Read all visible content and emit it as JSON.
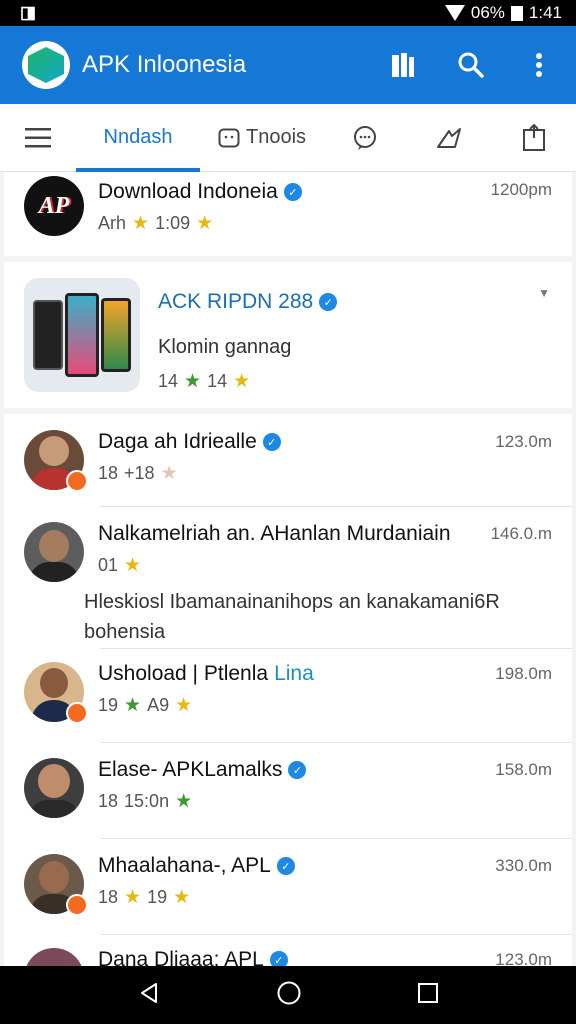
{
  "status_bar": {
    "battery": "06%",
    "time": "1:41"
  },
  "app_bar": {
    "title": "APK Inloonesia"
  },
  "tabs": [
    {
      "label": "Nndash",
      "active": true
    },
    {
      "label": "Tnoois",
      "active": false
    }
  ],
  "items": [
    {
      "name": "Download Indoneia",
      "sub_text": "Arh",
      "rating": "1:09",
      "time": "1200pm",
      "avatar": "AP"
    },
    {
      "name": "ACK RIPDN 288",
      "description": "Klomin gannag",
      "rating_a": "14",
      "rating_b": "14",
      "featured": true
    },
    {
      "name": "Daga ah Idriealle",
      "rating_a": "18",
      "rating_b": "+18",
      "time": "123.0m"
    },
    {
      "name": "Nalkamelriah an. AHanlan Murdaniain",
      "rating_a": "01",
      "time": "146.0.m",
      "description": "Hleskiosl Ibamanainanihops an kanakamani6R bohensia"
    },
    {
      "name": "Ushoload | Ptlenla",
      "name_link": "Lina",
      "rating_a": "19",
      "rating_b": "A9",
      "time": "198.0m"
    },
    {
      "name": "Elase- APKLamalks",
      "rating_a": "18",
      "rating_b": "15:0n",
      "time": "158.0m"
    },
    {
      "name": "Mhaalahana-, APL",
      "rating_a": "18",
      "rating_b": "19",
      "time": "330.0m"
    },
    {
      "name": "Dana Dliaaa: APL",
      "time": "123.0m"
    }
  ],
  "colors": {
    "primary": "#1577d6",
    "star_gold": "#e8b80e",
    "star_green": "#3a9a2c",
    "badge": "#f26b21"
  }
}
